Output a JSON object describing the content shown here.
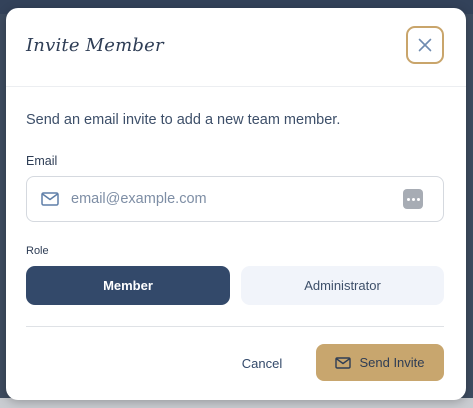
{
  "modal": {
    "title": "Invite Member",
    "close_icon": "close-icon",
    "description": "Send an email invite to add a new team member."
  },
  "email": {
    "label": "Email",
    "placeholder": "email@example.com",
    "value": "",
    "leading_icon": "mail-icon",
    "trailing_icon": "autofill-dots-icon"
  },
  "role": {
    "label": "Role",
    "options": [
      {
        "label": "Member",
        "selected": true
      },
      {
        "label": "Administrator",
        "selected": false
      }
    ]
  },
  "footer": {
    "cancel_label": "Cancel",
    "send_label": "Send Invite",
    "send_icon": "mail-icon"
  },
  "colors": {
    "primary": "#33496a",
    "accent": "#c8a66e",
    "secondary_bg": "#f1f4fa"
  }
}
